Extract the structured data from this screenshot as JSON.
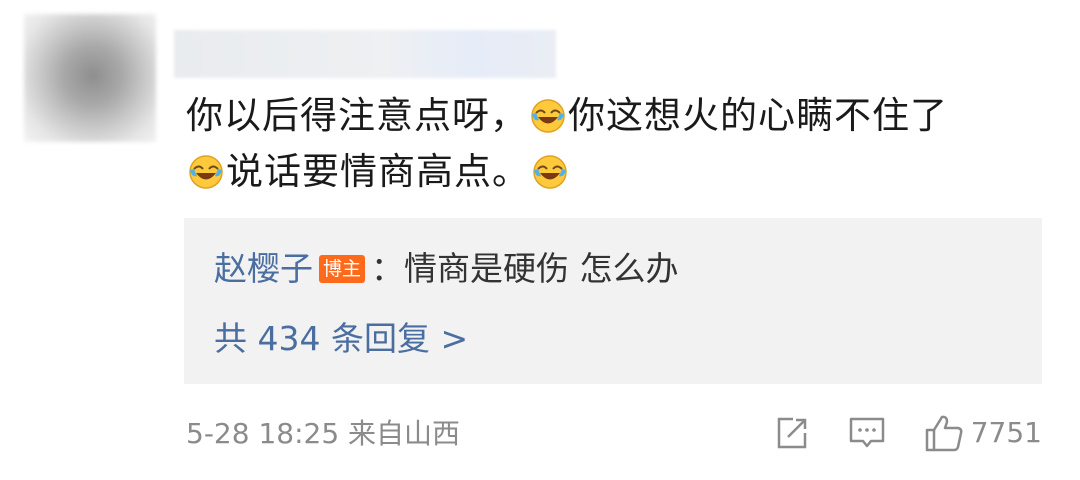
{
  "comment": {
    "line1_a": "你以后得注意点呀，",
    "emoji_1": "laughing-crying-emoji",
    "line1_b": "你这想火的心瞒不住了",
    "emoji_2": "laughing-crying-emoji",
    "line2_a": "说话要情商高点。",
    "emoji_3": "laughing-crying-emoji"
  },
  "reply": {
    "author": "赵樱子",
    "badge": "博主",
    "separator": "：",
    "content": "情商是硬伤  怎么办",
    "count_label": "共 434 条回复 >"
  },
  "footer": {
    "meta": "5-28 18:25 来自山西",
    "share_icon": "share-icon",
    "comment_icon": "comment-icon",
    "like_icon": "like-icon",
    "like_count": "7751"
  },
  "colors": {
    "link_blue": "#4a6e9f",
    "badge_orange": "#ff6a1a",
    "meta_gray": "#8b8b8b",
    "reply_bg": "#f2f2f2"
  }
}
